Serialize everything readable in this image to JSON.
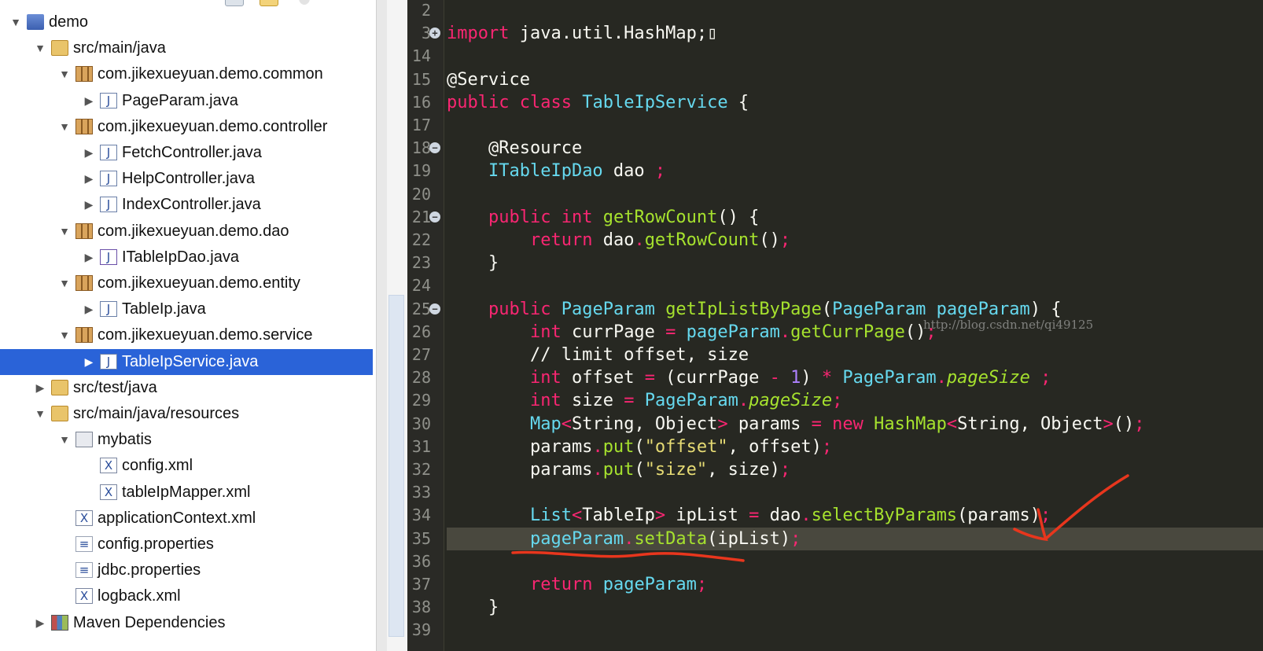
{
  "explorer": {
    "rows": [
      {
        "label": "demo",
        "depth": 0,
        "expanded": true,
        "icon": "project-icon"
      },
      {
        "label": "src/main/java",
        "depth": 1,
        "expanded": true,
        "icon": "source-folder-icon"
      },
      {
        "label": "com.jikexueyuan.demo.common",
        "depth": 2,
        "expanded": true,
        "icon": "package-icon"
      },
      {
        "label": "PageParam.java",
        "depth": 3,
        "expanded": false,
        "icon": "java-file-icon"
      },
      {
        "label": "com.jikexueyuan.demo.controller",
        "depth": 2,
        "expanded": true,
        "icon": "package-icon"
      },
      {
        "label": "FetchController.java",
        "depth": 3,
        "expanded": false,
        "icon": "java-file-icon"
      },
      {
        "label": "HelpController.java",
        "depth": 3,
        "expanded": false,
        "icon": "java-file-icon"
      },
      {
        "label": "IndexController.java",
        "depth": 3,
        "expanded": false,
        "icon": "java-file-icon"
      },
      {
        "label": "com.jikexueyuan.demo.dao",
        "depth": 2,
        "expanded": true,
        "icon": "package-icon"
      },
      {
        "label": "ITableIpDao.java",
        "depth": 3,
        "expanded": false,
        "icon": "java-interface-icon"
      },
      {
        "label": "com.jikexueyuan.demo.entity",
        "depth": 2,
        "expanded": true,
        "icon": "package-icon"
      },
      {
        "label": "TableIp.java",
        "depth": 3,
        "expanded": false,
        "icon": "java-file-icon"
      },
      {
        "label": "com.jikexueyuan.demo.service",
        "depth": 2,
        "expanded": true,
        "icon": "package-icon"
      },
      {
        "label": "TableIpService.java",
        "depth": 3,
        "expanded": false,
        "icon": "java-file-icon",
        "selected": true
      },
      {
        "label": "src/test/java",
        "depth": 1,
        "expanded": false,
        "icon": "source-folder-icon"
      },
      {
        "label": "src/main/java/resources",
        "depth": 1,
        "expanded": true,
        "icon": "source-folder-icon"
      },
      {
        "label": "mybatis",
        "depth": 2,
        "expanded": true,
        "icon": "folder-icon"
      },
      {
        "label": "config.xml",
        "depth": 3,
        "leaf": true,
        "icon": "xml-file-icon"
      },
      {
        "label": "tableIpMapper.xml",
        "depth": 3,
        "leaf": true,
        "icon": "xml-file-icon"
      },
      {
        "label": "applicationContext.xml",
        "depth": 2,
        "leaf": true,
        "icon": "xml-file-icon"
      },
      {
        "label": "config.properties",
        "depth": 2,
        "leaf": true,
        "icon": "properties-file-icon"
      },
      {
        "label": "jdbc.properties",
        "depth": 2,
        "leaf": true,
        "icon": "properties-file-icon"
      },
      {
        "label": "logback.xml",
        "depth": 2,
        "leaf": true,
        "icon": "xml-file-icon"
      },
      {
        "label": "Maven Dependencies",
        "depth": 1,
        "expanded": false,
        "icon": "library-icon"
      }
    ]
  },
  "editor": {
    "watermark": "http://blog.csdn.net/qi49125",
    "highlighted_line": "35",
    "lines": [
      {
        "n": "2",
        "t": []
      },
      {
        "n": "3",
        "fold": "+",
        "t": [
          [
            "kw",
            "import"
          ],
          [
            "pl",
            " java.util.HashMap;"
          ],
          [
            "pl",
            "▯"
          ]
        ]
      },
      {
        "n": "14",
        "t": []
      },
      {
        "n": "15",
        "t": [
          [
            "an",
            "@Service"
          ]
        ]
      },
      {
        "n": "16",
        "t": [
          [
            "kw",
            "public"
          ],
          [
            "pl",
            " "
          ],
          [
            "kw",
            "class"
          ],
          [
            "pl",
            " "
          ],
          [
            "ty",
            "TableIpService"
          ],
          [
            "pl",
            " {"
          ]
        ]
      },
      {
        "n": "17",
        "t": []
      },
      {
        "n": "18",
        "fold": "−",
        "t": [
          [
            "pl",
            "    "
          ],
          [
            "an",
            "@Resource"
          ]
        ]
      },
      {
        "n": "19",
        "t": [
          [
            "pl",
            "    "
          ],
          [
            "ty",
            "ITableIpDao"
          ],
          [
            "pl",
            " dao "
          ],
          [
            "op",
            ";"
          ]
        ]
      },
      {
        "n": "20",
        "t": []
      },
      {
        "n": "21",
        "fold": "−",
        "t": [
          [
            "pl",
            "    "
          ],
          [
            "kw",
            "public"
          ],
          [
            "pl",
            " "
          ],
          [
            "kw",
            "int"
          ],
          [
            "pl",
            " "
          ],
          [
            "fn",
            "getRowCount"
          ],
          [
            "pl",
            "() {"
          ]
        ]
      },
      {
        "n": "22",
        "t": [
          [
            "pl",
            "        "
          ],
          [
            "kw",
            "return"
          ],
          [
            "pl",
            " dao"
          ],
          [
            "op",
            "."
          ],
          [
            "fn",
            "getRowCount"
          ],
          [
            "pl",
            "()"
          ],
          [
            "op",
            ";"
          ]
        ]
      },
      {
        "n": "23",
        "t": [
          [
            "pl",
            "    }"
          ]
        ]
      },
      {
        "n": "24",
        "t": []
      },
      {
        "n": "25",
        "fold": "−",
        "t": [
          [
            "pl",
            "    "
          ],
          [
            "kw",
            "public"
          ],
          [
            "pl",
            " "
          ],
          [
            "ty",
            "PageParam"
          ],
          [
            "pl",
            " "
          ],
          [
            "fn",
            "getIpListByPage"
          ],
          [
            "pl",
            "("
          ],
          [
            "ty",
            "PageParam"
          ],
          [
            "pl",
            " "
          ],
          [
            "ty",
            "pageParam"
          ],
          [
            "pl",
            ") {"
          ]
        ]
      },
      {
        "n": "26",
        "t": [
          [
            "pl",
            "        "
          ],
          [
            "kw",
            "int"
          ],
          [
            "pl",
            " currPage "
          ],
          [
            "op",
            "="
          ],
          [
            "pl",
            " "
          ],
          [
            "ty",
            "pageParam"
          ],
          [
            "op",
            "."
          ],
          [
            "fn",
            "getCurrPage"
          ],
          [
            "pl",
            "()"
          ],
          [
            "op",
            ";"
          ]
        ]
      },
      {
        "n": "27",
        "t": [
          [
            "pl",
            "        // limit offset, size"
          ]
        ]
      },
      {
        "n": "28",
        "t": [
          [
            "pl",
            "        "
          ],
          [
            "kw",
            "int"
          ],
          [
            "pl",
            " offset "
          ],
          [
            "op",
            "="
          ],
          [
            "pl",
            " (currPage "
          ],
          [
            "op",
            "-"
          ],
          [
            "pl",
            " "
          ],
          [
            "nu",
            "1"
          ],
          [
            "pl",
            ") "
          ],
          [
            "op",
            "*"
          ],
          [
            "pl",
            " "
          ],
          [
            "ty",
            "PageParam"
          ],
          [
            "op",
            "."
          ],
          [
            "it",
            "pageSize"
          ],
          [
            "pl",
            " "
          ],
          [
            "op",
            ";"
          ]
        ]
      },
      {
        "n": "29",
        "t": [
          [
            "pl",
            "        "
          ],
          [
            "kw",
            "int"
          ],
          [
            "pl",
            " size "
          ],
          [
            "op",
            "="
          ],
          [
            "pl",
            " "
          ],
          [
            "ty",
            "PageParam"
          ],
          [
            "op",
            "."
          ],
          [
            "it",
            "pageSize"
          ],
          [
            "op",
            ";"
          ]
        ]
      },
      {
        "n": "30",
        "t": [
          [
            "pl",
            "        "
          ],
          [
            "ty",
            "Map"
          ],
          [
            "op",
            "<"
          ],
          [
            "pl",
            "String, Object"
          ],
          [
            "op",
            ">"
          ],
          [
            "pl",
            " params "
          ],
          [
            "op",
            "="
          ],
          [
            "pl",
            " "
          ],
          [
            "kw",
            "new"
          ],
          [
            "pl",
            " "
          ],
          [
            "fn",
            "HashMap"
          ],
          [
            "op",
            "<"
          ],
          [
            "pl",
            "String, Object"
          ],
          [
            "op",
            ">"
          ],
          [
            "pl",
            "()"
          ],
          [
            "op",
            ";"
          ]
        ]
      },
      {
        "n": "31",
        "t": [
          [
            "pl",
            "        params"
          ],
          [
            "op",
            "."
          ],
          [
            "fn",
            "put"
          ],
          [
            "pl",
            "("
          ],
          [
            "st",
            "\"offset\""
          ],
          [
            "pl",
            ", offset)"
          ],
          [
            "op",
            ";"
          ]
        ]
      },
      {
        "n": "32",
        "t": [
          [
            "pl",
            "        params"
          ],
          [
            "op",
            "."
          ],
          [
            "fn",
            "put"
          ],
          [
            "pl",
            "("
          ],
          [
            "st",
            "\"size\""
          ],
          [
            "pl",
            ", size)"
          ],
          [
            "op",
            ";"
          ]
        ]
      },
      {
        "n": "33",
        "t": []
      },
      {
        "n": "34",
        "t": [
          [
            "pl",
            "        "
          ],
          [
            "ty",
            "List"
          ],
          [
            "op",
            "<"
          ],
          [
            "pl",
            "TableIp"
          ],
          [
            "op",
            ">"
          ],
          [
            "pl",
            " ipList "
          ],
          [
            "op",
            "="
          ],
          [
            "pl",
            " dao"
          ],
          [
            "op",
            "."
          ],
          [
            "fn",
            "selectByParams"
          ],
          [
            "pl",
            "(params)"
          ],
          [
            "op",
            ";"
          ]
        ]
      },
      {
        "n": "35",
        "t": [
          [
            "pl",
            "        "
          ],
          [
            "ty",
            "pageParam"
          ],
          [
            "op",
            "."
          ],
          [
            "fn",
            "setData"
          ],
          [
            "pl",
            "(ipList)"
          ],
          [
            "op",
            ";"
          ]
        ]
      },
      {
        "n": "36",
        "t": []
      },
      {
        "n": "37",
        "t": [
          [
            "pl",
            "        "
          ],
          [
            "kw",
            "return"
          ],
          [
            "pl",
            " "
          ],
          [
            "ty",
            "pageParam"
          ],
          [
            "op",
            ";"
          ]
        ]
      },
      {
        "n": "38",
        "t": [
          [
            "pl",
            "    }"
          ]
        ]
      },
      {
        "n": "39",
        "t": []
      }
    ]
  },
  "colors": {
    "editor_bg": "#272822",
    "selection": "#2a63d8",
    "annotation": "#e8361d"
  }
}
